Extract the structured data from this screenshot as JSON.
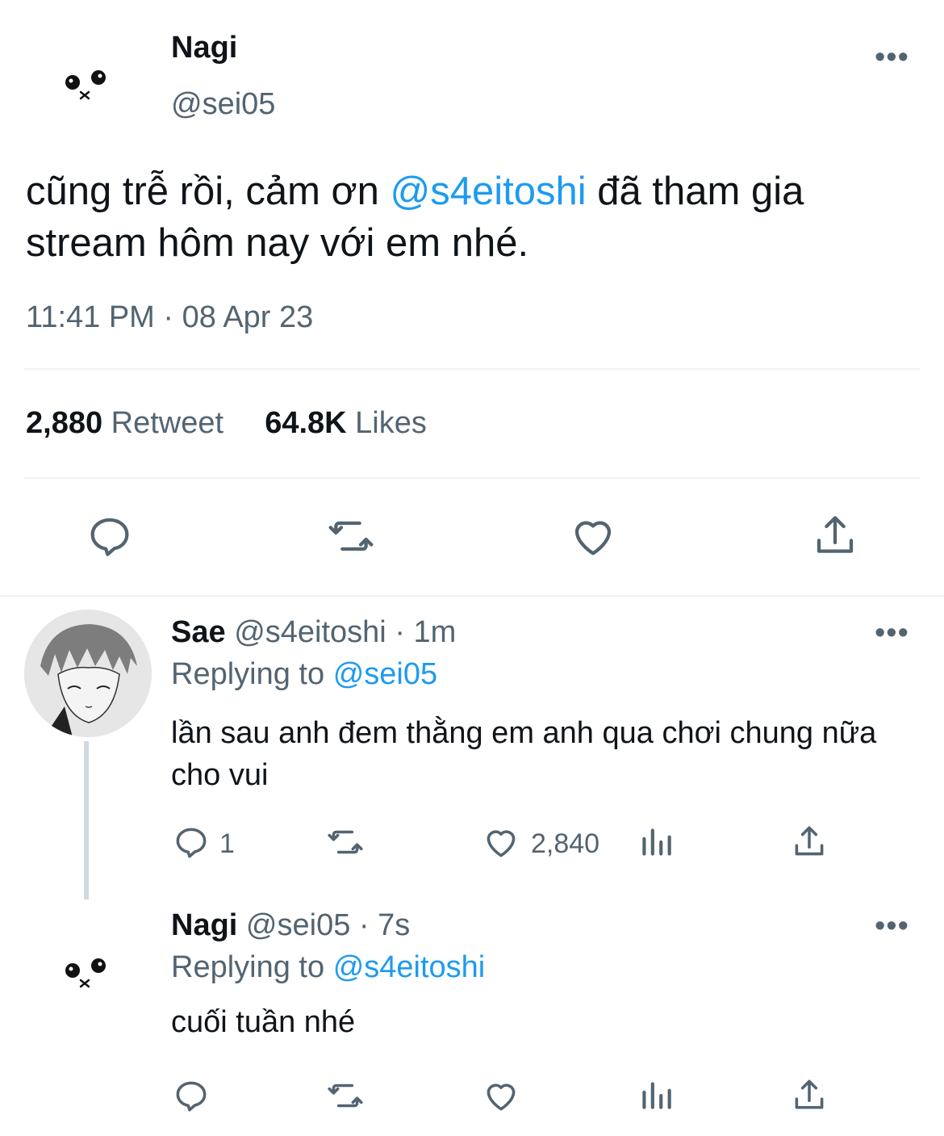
{
  "main_tweet": {
    "name": "Nagi",
    "handle": "@sei05",
    "text_before": "cũng trễ rồi, cảm ơn ",
    "mention": "@s4eitoshi",
    "text_after": " đã tham gia stream hôm nay với em nhé.",
    "timestamp": "11:41 PM · 08 Apr 23",
    "retweet_count": "2,880",
    "retweet_label": "Retweet",
    "likes_count": "64.8K",
    "likes_label": "Likes",
    "more": "•••"
  },
  "replies": [
    {
      "name": "Sae",
      "handle": "@s4eitoshi",
      "time": "· 1m",
      "replying_label": "Replying to",
      "replying_to": "@sei05",
      "text": "lần sau anh đem thằng em anh qua chơi chung nữa cho vui",
      "reply_count": "1",
      "like_count": "2,840",
      "more": "•••"
    },
    {
      "name": "Nagi",
      "handle": "@sei05",
      "time": "· 7s",
      "replying_label": "Replying to",
      "replying_to": "@s4eitoshi",
      "text": "cuối tuần nhé",
      "more": "•••"
    }
  ],
  "colors": {
    "accent": "#1d9bf0",
    "text": "#0f1419",
    "secondary": "#536471",
    "divider": "#eff3f4"
  },
  "icons": [
    "reply-icon",
    "retweet-icon",
    "like-icon",
    "share-icon",
    "analytics-icon",
    "more-icon"
  ]
}
